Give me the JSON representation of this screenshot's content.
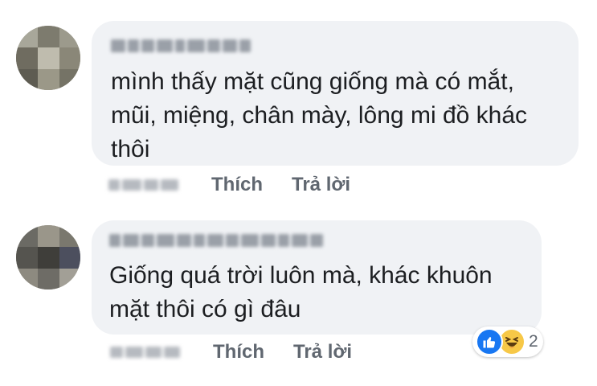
{
  "comments": [
    {
      "author": "",
      "text": "mình thấy mặt cũng giống mà có mắt,\nmũi, miệng, chân mày, lông mi đồ khác\nthôi",
      "timestamp": "",
      "like_label": "Thích",
      "reply_label": "Trả lời"
    },
    {
      "author": "",
      "text": "Giống quá trời luôn mà, khác khuôn\nmặt thôi có gì đâu",
      "timestamp": "",
      "like_label": "Thích",
      "reply_label": "Trả lời",
      "reactions": {
        "types": [
          "like",
          "haha"
        ],
        "count": "2"
      }
    }
  ],
  "colors": {
    "bubble": "#f0f2f5",
    "action_text": "#606770",
    "like_blue": "#1877f2",
    "haha_yellow": "#f7c847"
  }
}
